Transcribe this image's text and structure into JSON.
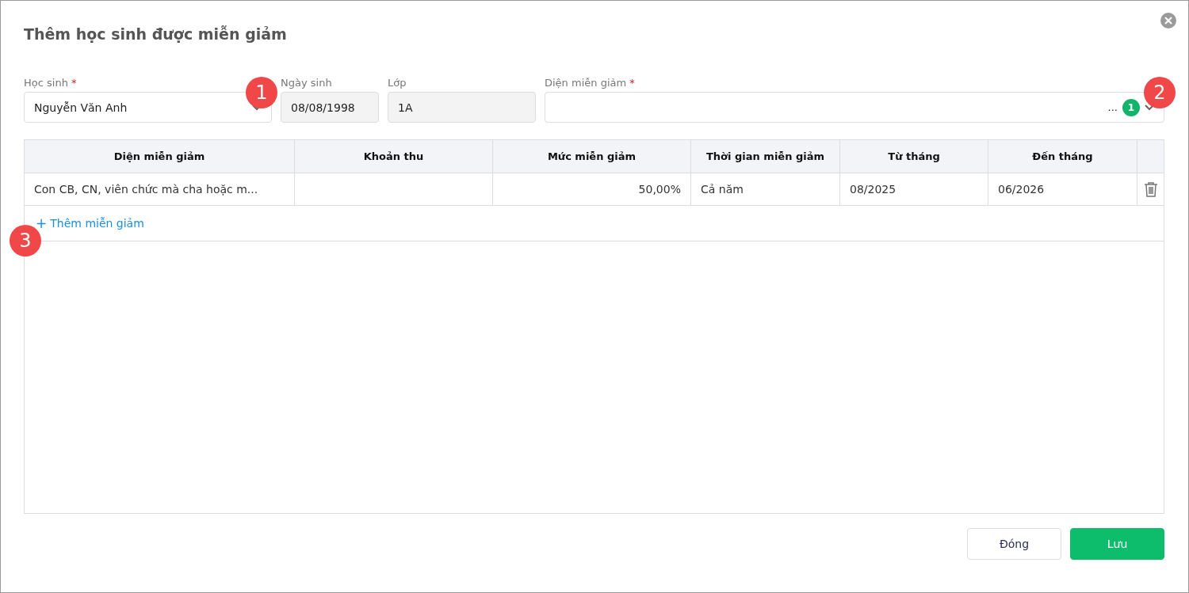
{
  "dialog": {
    "title": "Thêm học sinh được miễn giảm"
  },
  "fields": [
    {
      "kind": "select",
      "label": "Học sinh",
      "required": true,
      "value": "Nguyễn Văn Anh",
      "disabled": false
    },
    {
      "kind": "text",
      "label": "Ngày sinh",
      "required": false,
      "value": "08/08/1998",
      "disabled": true
    },
    {
      "kind": "text",
      "label": "Lớp",
      "required": false,
      "value": "1A",
      "disabled": true
    },
    {
      "kind": "multiselect",
      "label": "Diện miễn giảm",
      "required": true,
      "value": "...",
      "count": "1",
      "disabled": false
    }
  ],
  "required_mark": "*",
  "table": {
    "columns": [
      "Diện miễn giảm",
      "Khoản thu",
      "Mức miễn giảm",
      "Thời gian miễn giảm",
      "Từ tháng",
      "Đến tháng"
    ],
    "rows": [
      [
        "Con CB, CN, viên chức mà cha hoặc m...",
        "",
        "50,00%",
        "Cả năm",
        "08/2025",
        "06/2026"
      ]
    ],
    "add_link": {
      "icon": "+",
      "label": "Thêm miễn giảm"
    }
  },
  "buttons": [
    {
      "label": "Đóng",
      "kind": "secondary"
    },
    {
      "label": "Lưu",
      "kind": "primary"
    }
  ],
  "callouts": [
    "1",
    "2",
    "3"
  ]
}
